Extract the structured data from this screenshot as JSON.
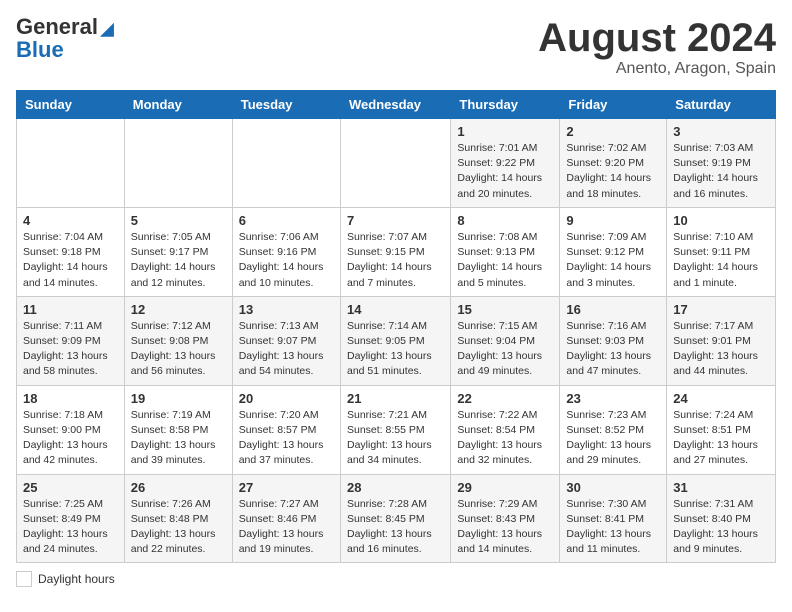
{
  "header": {
    "logo_general": "General",
    "logo_blue": "Blue",
    "title": "August 2024",
    "location": "Anento, Aragon, Spain"
  },
  "days_of_week": [
    "Sunday",
    "Monday",
    "Tuesday",
    "Wednesday",
    "Thursday",
    "Friday",
    "Saturday"
  ],
  "weeks": [
    [
      {
        "day": "",
        "info": ""
      },
      {
        "day": "",
        "info": ""
      },
      {
        "day": "",
        "info": ""
      },
      {
        "day": "",
        "info": ""
      },
      {
        "day": "1",
        "info": "Sunrise: 7:01 AM\nSunset: 9:22 PM\nDaylight: 14 hours\nand 20 minutes."
      },
      {
        "day": "2",
        "info": "Sunrise: 7:02 AM\nSunset: 9:20 PM\nDaylight: 14 hours\nand 18 minutes."
      },
      {
        "day": "3",
        "info": "Sunrise: 7:03 AM\nSunset: 9:19 PM\nDaylight: 14 hours\nand 16 minutes."
      }
    ],
    [
      {
        "day": "4",
        "info": "Sunrise: 7:04 AM\nSunset: 9:18 PM\nDaylight: 14 hours\nand 14 minutes."
      },
      {
        "day": "5",
        "info": "Sunrise: 7:05 AM\nSunset: 9:17 PM\nDaylight: 14 hours\nand 12 minutes."
      },
      {
        "day": "6",
        "info": "Sunrise: 7:06 AM\nSunset: 9:16 PM\nDaylight: 14 hours\nand 10 minutes."
      },
      {
        "day": "7",
        "info": "Sunrise: 7:07 AM\nSunset: 9:15 PM\nDaylight: 14 hours\nand 7 minutes."
      },
      {
        "day": "8",
        "info": "Sunrise: 7:08 AM\nSunset: 9:13 PM\nDaylight: 14 hours\nand 5 minutes."
      },
      {
        "day": "9",
        "info": "Sunrise: 7:09 AM\nSunset: 9:12 PM\nDaylight: 14 hours\nand 3 minutes."
      },
      {
        "day": "10",
        "info": "Sunrise: 7:10 AM\nSunset: 9:11 PM\nDaylight: 14 hours\nand 1 minute."
      }
    ],
    [
      {
        "day": "11",
        "info": "Sunrise: 7:11 AM\nSunset: 9:09 PM\nDaylight: 13 hours\nand 58 minutes."
      },
      {
        "day": "12",
        "info": "Sunrise: 7:12 AM\nSunset: 9:08 PM\nDaylight: 13 hours\nand 56 minutes."
      },
      {
        "day": "13",
        "info": "Sunrise: 7:13 AM\nSunset: 9:07 PM\nDaylight: 13 hours\nand 54 minutes."
      },
      {
        "day": "14",
        "info": "Sunrise: 7:14 AM\nSunset: 9:05 PM\nDaylight: 13 hours\nand 51 minutes."
      },
      {
        "day": "15",
        "info": "Sunrise: 7:15 AM\nSunset: 9:04 PM\nDaylight: 13 hours\nand 49 minutes."
      },
      {
        "day": "16",
        "info": "Sunrise: 7:16 AM\nSunset: 9:03 PM\nDaylight: 13 hours\nand 47 minutes."
      },
      {
        "day": "17",
        "info": "Sunrise: 7:17 AM\nSunset: 9:01 PM\nDaylight: 13 hours\nand 44 minutes."
      }
    ],
    [
      {
        "day": "18",
        "info": "Sunrise: 7:18 AM\nSunset: 9:00 PM\nDaylight: 13 hours\nand 42 minutes."
      },
      {
        "day": "19",
        "info": "Sunrise: 7:19 AM\nSunset: 8:58 PM\nDaylight: 13 hours\nand 39 minutes."
      },
      {
        "day": "20",
        "info": "Sunrise: 7:20 AM\nSunset: 8:57 PM\nDaylight: 13 hours\nand 37 minutes."
      },
      {
        "day": "21",
        "info": "Sunrise: 7:21 AM\nSunset: 8:55 PM\nDaylight: 13 hours\nand 34 minutes."
      },
      {
        "day": "22",
        "info": "Sunrise: 7:22 AM\nSunset: 8:54 PM\nDaylight: 13 hours\nand 32 minutes."
      },
      {
        "day": "23",
        "info": "Sunrise: 7:23 AM\nSunset: 8:52 PM\nDaylight: 13 hours\nand 29 minutes."
      },
      {
        "day": "24",
        "info": "Sunrise: 7:24 AM\nSunset: 8:51 PM\nDaylight: 13 hours\nand 27 minutes."
      }
    ],
    [
      {
        "day": "25",
        "info": "Sunrise: 7:25 AM\nSunset: 8:49 PM\nDaylight: 13 hours\nand 24 minutes."
      },
      {
        "day": "26",
        "info": "Sunrise: 7:26 AM\nSunset: 8:48 PM\nDaylight: 13 hours\nand 22 minutes."
      },
      {
        "day": "27",
        "info": "Sunrise: 7:27 AM\nSunset: 8:46 PM\nDaylight: 13 hours\nand 19 minutes."
      },
      {
        "day": "28",
        "info": "Sunrise: 7:28 AM\nSunset: 8:45 PM\nDaylight: 13 hours\nand 16 minutes."
      },
      {
        "day": "29",
        "info": "Sunrise: 7:29 AM\nSunset: 8:43 PM\nDaylight: 13 hours\nand 14 minutes."
      },
      {
        "day": "30",
        "info": "Sunrise: 7:30 AM\nSunset: 8:41 PM\nDaylight: 13 hours\nand 11 minutes."
      },
      {
        "day": "31",
        "info": "Sunrise: 7:31 AM\nSunset: 8:40 PM\nDaylight: 13 hours\nand 9 minutes."
      }
    ]
  ],
  "footer": {
    "daylight_label": "Daylight hours"
  }
}
